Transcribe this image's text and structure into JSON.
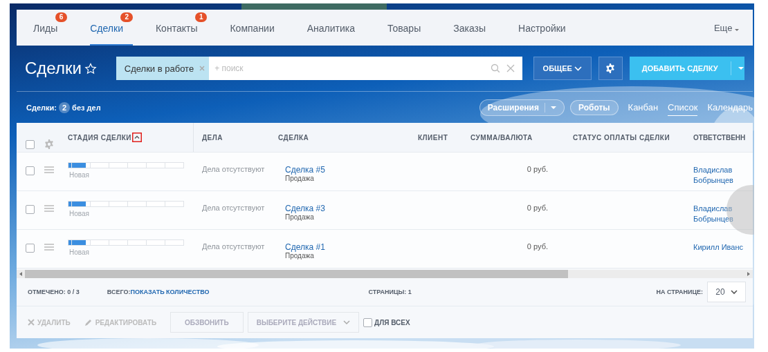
{
  "nav": {
    "items": [
      {
        "label": "Лиды",
        "badge": "6",
        "selected": false
      },
      {
        "label": "Сделки",
        "badge": "2",
        "selected": true
      },
      {
        "label": "Контакты",
        "badge": "1",
        "selected": false
      },
      {
        "label": "Компании",
        "selected": false
      },
      {
        "label": "Аналитика",
        "selected": false
      },
      {
        "label": "Товары",
        "selected": false
      },
      {
        "label": "Заказы",
        "selected": false
      },
      {
        "label": "Настройки",
        "selected": false
      }
    ],
    "more": "Еще"
  },
  "header": {
    "title": "Сделки",
    "filter_chip": "Сделки в работе",
    "search_placeholder": "+ поиск",
    "preset_button": "ОБЩЕЕ",
    "add_button": "ДОБАВИТЬ СДЕЛКУ"
  },
  "toolbar": {
    "counter_label": "Сделки:",
    "counter": "2",
    "counter_suffix": "без дел",
    "extensions": "Расширения",
    "robots": "Роботы",
    "views": [
      {
        "label": "Канбан",
        "selected": false
      },
      {
        "label": "Список",
        "selected": true
      },
      {
        "label": "Календарь",
        "selected": false
      }
    ]
  },
  "table": {
    "all_checked": false,
    "columns": [
      "СТАДИЯ СДЕЛКИ",
      "ДЕЛА",
      "СДЕЛКА",
      "КЛИЕНТ",
      "СУММА/ВАЛЮТА",
      "СТАТУС ОПЛАТЫ СДЕЛКИ",
      "ОТВЕТСТВЕНН"
    ],
    "rows": [
      {
        "checked": false,
        "level": 0.15,
        "stage": "Новая",
        "activities": "Дела отсутствуют",
        "deal": "Сделка #5",
        "deal_type": "Продажа",
        "amount": "0 руб.",
        "responsible": "Владислав Бобрынцев"
      },
      {
        "checked": false,
        "level": 0.15,
        "stage": "Новая",
        "activities": "Дела отсутствуют",
        "deal": "Сделка #3",
        "deal_type": "Продажа",
        "amount": "0 руб.",
        "responsible": "Владислав Бобрынцев"
      },
      {
        "checked": false,
        "level": 0.15,
        "stage": "Новая",
        "activities": "Дела отсутствуют",
        "deal": "Сделка #1",
        "deal_type": "Продажа",
        "amount": "0 руб.",
        "responsible": "Кирилл Иванс"
      }
    ]
  },
  "footer": {
    "marked_label": "ОТМЕЧЕНО: 0 / 3",
    "total_label": "ВСЕГО:",
    "total_link": "ПОКАЗАТЬ КОЛИЧЕСТВО",
    "pages": "СТРАНИЦЫ: 1",
    "per_page_label": "НА СТРАНИЦЕ:",
    "per_page": "20"
  },
  "actions": {
    "delete": "УДАЛИТЬ",
    "edit": "РЕДАКТИРОВАТЬ",
    "call": "ОБЗВОНИТЬ",
    "select_action": "ВЫБЕРИТЕ ДЕЙСТВИЕ",
    "for_all": "ДЛЯ ВСЕХ",
    "for_all_checked": false
  }
}
